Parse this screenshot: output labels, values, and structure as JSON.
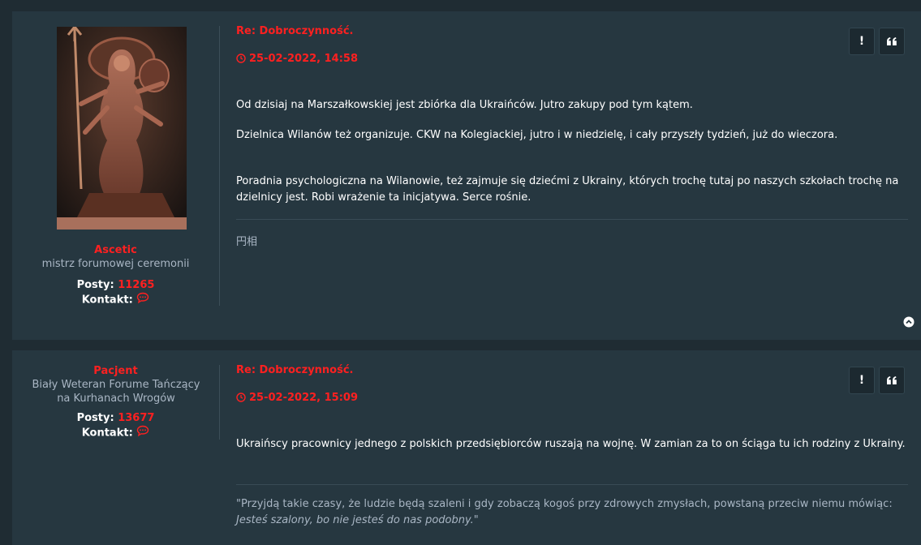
{
  "posts": [
    {
      "author": "Ascetic",
      "rank": "mistrz forumowej ceremonii",
      "posts_label": "Posty:",
      "posts_count": "11265",
      "contact_label": "Kontakt:",
      "title": "Re: Dobroczynność.",
      "date": "25-02-2022, 14:58",
      "paragraphs": [
        "Od dzisiaj na Marszałkowskiej jest zbiórka dla Ukraińców. Jutro zakupy pod tym kątem.",
        "Dzielnica Wilanów też organizuje. CKW na Kolegiackiej, jutro i w niedzielę, i cały przyszły tydzień, już do wieczora.",
        "Poradnia psychologiczna na Wilanowie, też zajmuje się dziećmi z Ukrainy, których trochę tutaj po naszych szkołach trochę na dzielnicy jest. Robi wrażenie ta inicjatywa. Serce rośnie."
      ],
      "signature": "円相",
      "report_label": "!"
    },
    {
      "author": "Pacjent",
      "rank": "Biały Weteran Forume Tańczący na Kurhanach Wrogów",
      "posts_label": "Posty:",
      "posts_count": "13677",
      "contact_label": "Kontakt:",
      "title": "Re: Dobroczynność.",
      "date": "25-02-2022, 15:09",
      "paragraphs": [
        "Ukraińscy pracownicy jednego z polskich przedsiębiorców ruszają na wojnę. W zamian za to on ściąga tu ich rodziny z Ukrainy."
      ],
      "signature_quote_line1": "\"Przyjdą takie czasy, że ludzie będą szaleni i gdy zobaczą kogoś przy zdrowych zmysłach, powstaną przeciw niemu mówiąc:",
      "signature_quote_line2": "Jesteś szalony, bo nie jesteś do nas podobny.",
      "signature_quote_end": "\"",
      "report_label": "!"
    }
  ],
  "colors": {
    "accent": "#ff2020",
    "page_bg": "#1f2c33",
    "post_bg": "#263740",
    "muted": "#a9b6c4"
  },
  "icons": [
    "clock-icon",
    "chat-icon",
    "quote-icon",
    "report-icon",
    "back-to-top-icon"
  ]
}
